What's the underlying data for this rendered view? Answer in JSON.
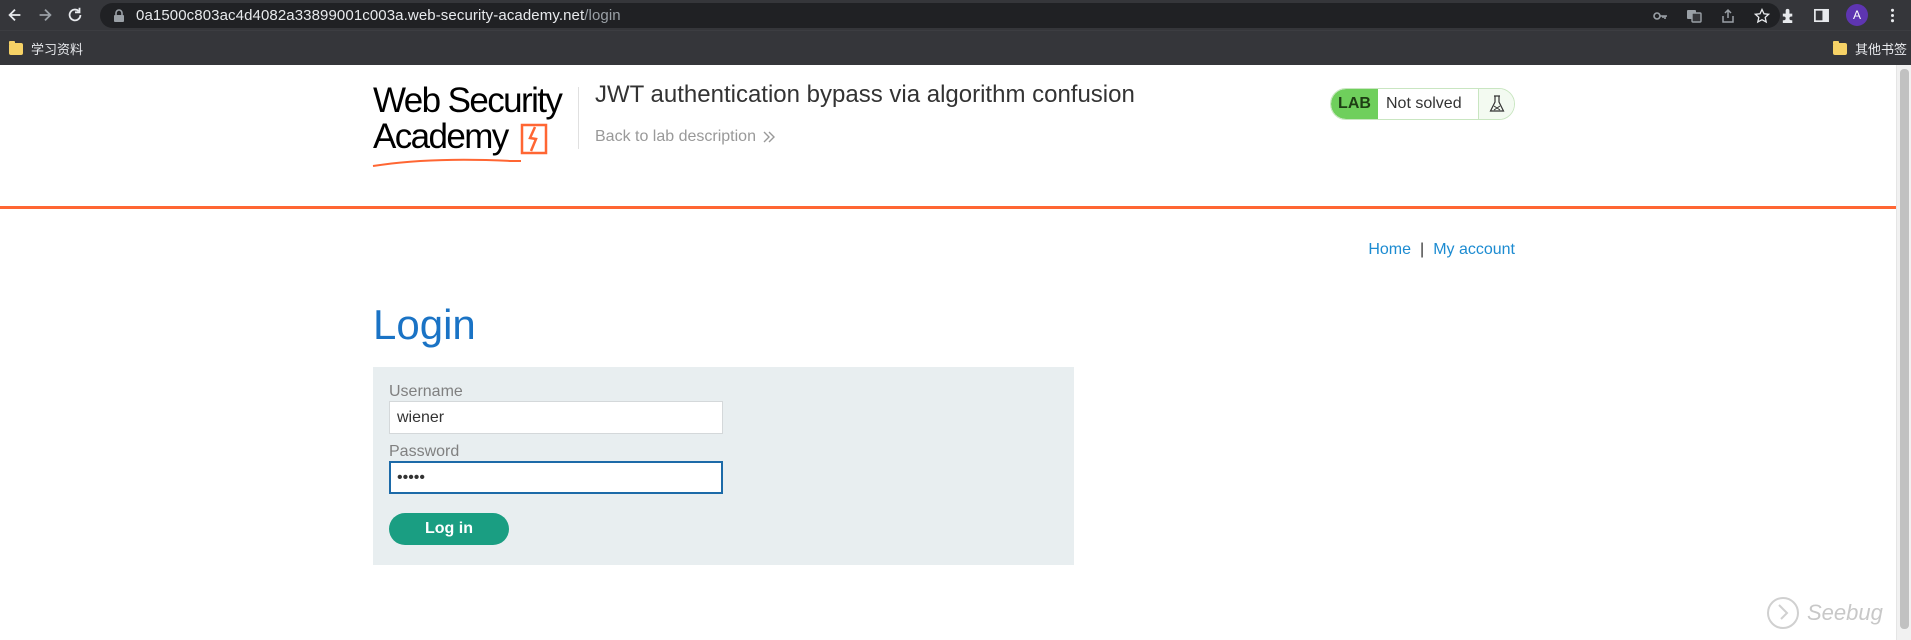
{
  "browser": {
    "url_host": "0a1500c803ac4d4082a33899001c003a.web-security-academy.net",
    "url_path": "/login",
    "profile_initial": "A",
    "icons": [
      "back-icon",
      "forward-icon",
      "reload-icon",
      "lock-icon",
      "key-icon",
      "translate-icon",
      "share-icon",
      "star-icon",
      "extensions-icon",
      "sidebar-icon",
      "menu-icon"
    ]
  },
  "bookmarks": {
    "left_folder": "学习资料",
    "right_folder": "其他书签"
  },
  "header": {
    "logo_line1": "Web Security",
    "logo_line2": "Academy",
    "lab_title": "JWT authentication bypass via algorithm confusion",
    "back_link": "Back to lab description",
    "status_tag": "LAB",
    "status_text": "Not solved",
    "accent_color": "#ff6633"
  },
  "nav": {
    "home": "Home",
    "separator": "|",
    "account": "My account"
  },
  "main": {
    "title": "Login",
    "username_label": "Username",
    "username_value": "wiener",
    "password_label": "Password",
    "password_value": "•••••",
    "submit_label": "Log in",
    "button_color": "#1a9e82"
  },
  "watermark": "Seebug"
}
